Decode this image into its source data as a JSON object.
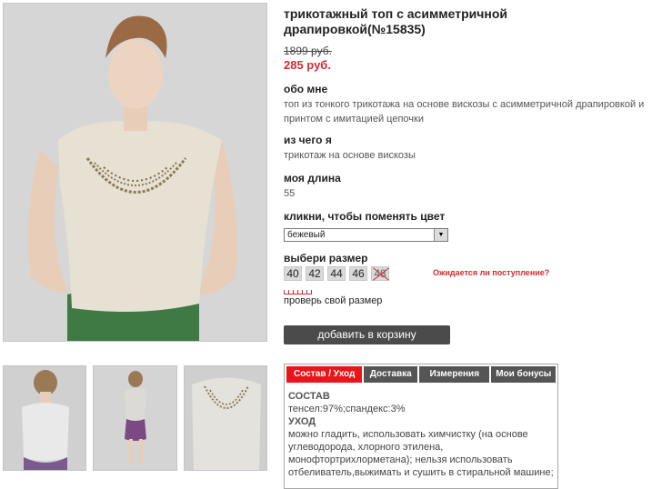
{
  "product": {
    "title": "трикотажный топ с асимметричной драпировкой(№15835)",
    "old_price": "1899 руб.",
    "new_price": "285 руб."
  },
  "about": {
    "heading": "обо мне",
    "text": "топ из тонкого трикотажа на основе вискозы с асимметричной драпировкой и принтом с имитацией цепочки"
  },
  "material": {
    "heading": "из чего я",
    "text": "трикотаж на основе вискозы"
  },
  "length": {
    "heading": "моя длина",
    "value": "55"
  },
  "color": {
    "heading": "кликни, чтобы поменять цвет",
    "selected": "бежевый"
  },
  "size": {
    "heading": "выбери размер",
    "options": [
      "40",
      "42",
      "44",
      "46",
      "48"
    ],
    "expect_link": "Ожидается ли поступление?",
    "check_size": "проверь свой размер"
  },
  "cart": {
    "button_label": "добавить в корзину"
  },
  "tabs": {
    "items": [
      "Состав / Уход",
      "Доставка",
      "Измерения",
      "Мои бонусы"
    ],
    "content": {
      "composition_heading": "СОСТАВ",
      "composition": "тенсел:97%;спандекс:3%",
      "care_heading": "УХОД",
      "care": "можно гладить, использовать химчистку (на основе углеводорода, хлорного этилена, монофтортрихлорметана); нельзя использовать отбеливатель,выжимать и сушить в стиральной машине;"
    }
  },
  "colors": {
    "accent": "#e8161b",
    "price": "#d7282f",
    "button": "#4b4b4b",
    "tab": "#555555"
  }
}
